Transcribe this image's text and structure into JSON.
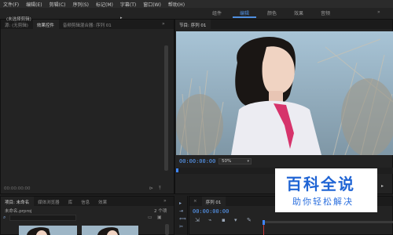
{
  "menubar": {
    "items": [
      "文件(F)",
      "编辑(E)",
      "剪辑(C)",
      "序列(S)",
      "标记(M)",
      "字幕(T)",
      "窗口(W)",
      "帮助(H)"
    ]
  },
  "workspace": {
    "tabs": [
      "组件",
      "编辑",
      "颜色",
      "效果",
      "音频"
    ],
    "active": "编辑",
    "accent": "#4f8fe0"
  },
  "source_panel": {
    "tabs": [
      "源: (无剪辑)",
      "效果控件",
      "音频剪辑混合器: 序列 01"
    ],
    "no_clip": "(未选择剪辑)",
    "timecode": "00:00:00:00"
  },
  "program_panel": {
    "tab": "节目: 序列 01",
    "timecode": "00:00:00:00",
    "zoom": "50%"
  },
  "project_panel": {
    "tabs": [
      "项目: 未命名",
      "媒体浏览器",
      "库",
      "信息",
      "效果"
    ],
    "project_file": "未命名.prproj",
    "item_count": "2 个项"
  },
  "timeline_panel": {
    "tab": "序列 01",
    "timecode": "00:00:00:00"
  },
  "watermark": {
    "title": "百科全说",
    "subtitle": "助你轻松解决",
    "color": "#1f64d4"
  },
  "icons": {
    "search": "search-icon",
    "wrench": "wrench-icon",
    "marker": "marker-icon",
    "snap": "snap-icon"
  }
}
